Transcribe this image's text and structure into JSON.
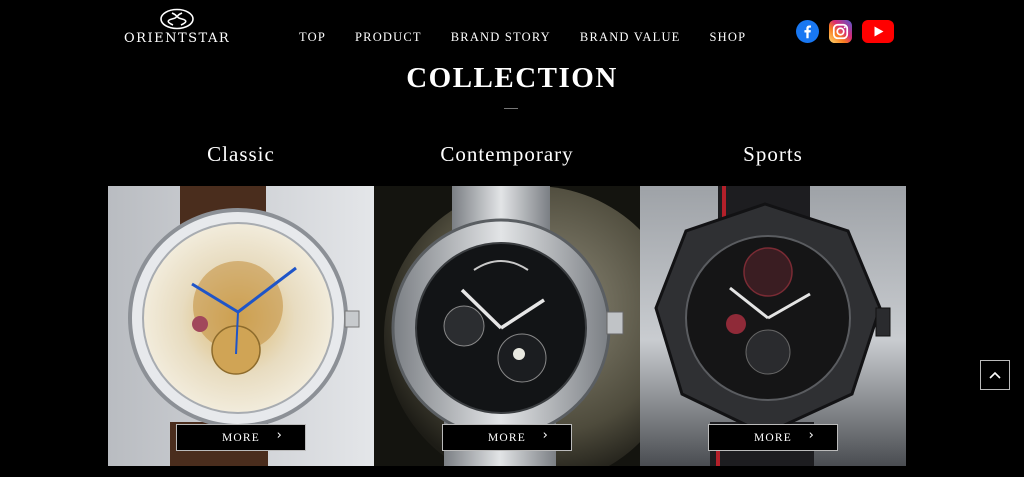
{
  "brand": {
    "name": "ORIENTSTAR",
    "logo_icon": "orient-star-emblem"
  },
  "nav": {
    "items": [
      {
        "label": "TOP"
      },
      {
        "label": "PRODUCT"
      },
      {
        "label": "BRAND STORY"
      },
      {
        "label": "BRAND VALUE"
      },
      {
        "label": "SHOP"
      }
    ]
  },
  "social": {
    "icons": [
      "facebook-icon",
      "instagram-icon",
      "youtube-icon"
    ],
    "colors": {
      "facebook": "#1877F2",
      "instagram": "#D6249F",
      "youtube": "#FF0000"
    }
  },
  "section": {
    "title": "COLLECTION"
  },
  "collections": [
    {
      "title": "Classic",
      "more_label": "MORE",
      "image_icon": "skeleton-classic-watch"
    },
    {
      "title": "Contemporary",
      "more_label": "MORE",
      "image_icon": "moon-phase-steel-watch"
    },
    {
      "title": "Sports",
      "more_label": "MORE",
      "image_icon": "black-sport-skeleton-watch"
    }
  ],
  "back_to_top": {
    "icon": "chevron-up-icon"
  },
  "colors": {
    "background": "#000000",
    "text": "#ffffff",
    "button_border": "#bbbbbb"
  }
}
